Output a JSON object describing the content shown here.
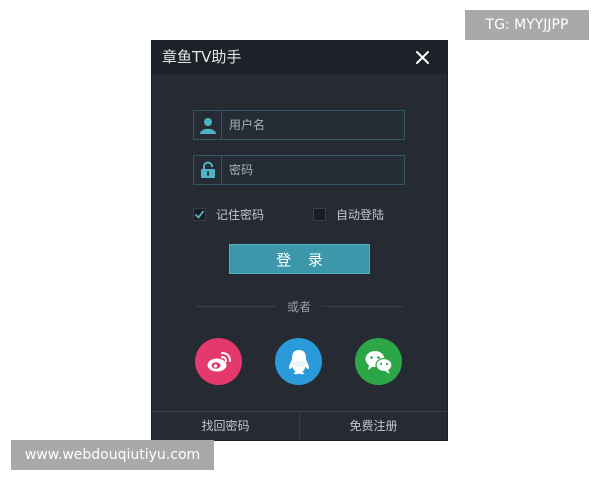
{
  "watermarks": {
    "top_right": "TG: MYYJJPP",
    "bottom_left": "www.webdouqiutiyu.com"
  },
  "window": {
    "title": "章鱼TV助手",
    "close_icon": "close-icon"
  },
  "form": {
    "username": {
      "placeholder": "用户名",
      "value": "",
      "icon": "user-icon"
    },
    "password": {
      "placeholder": "密码",
      "value": "",
      "icon": "lock-icon"
    },
    "remember": {
      "label": "记住密码",
      "checked": true
    },
    "auto_login": {
      "label": "自动登陆",
      "checked": false
    },
    "login_label": "登 录"
  },
  "divider": {
    "label": "或者"
  },
  "social": [
    {
      "name": "weibo",
      "icon": "weibo-icon",
      "color": "#e5386d"
    },
    {
      "name": "qq",
      "icon": "qq-icon",
      "color": "#2a9ad9"
    },
    {
      "name": "wechat",
      "icon": "wechat-icon",
      "color": "#2da647"
    }
  ],
  "footer": {
    "recover": "找回密码",
    "register": "免费注册"
  },
  "colors": {
    "dialog_bg": "#252a33",
    "titlebar_bg": "#1d2128",
    "accent": "#3b97a9",
    "field_border": "#2d5a66"
  }
}
